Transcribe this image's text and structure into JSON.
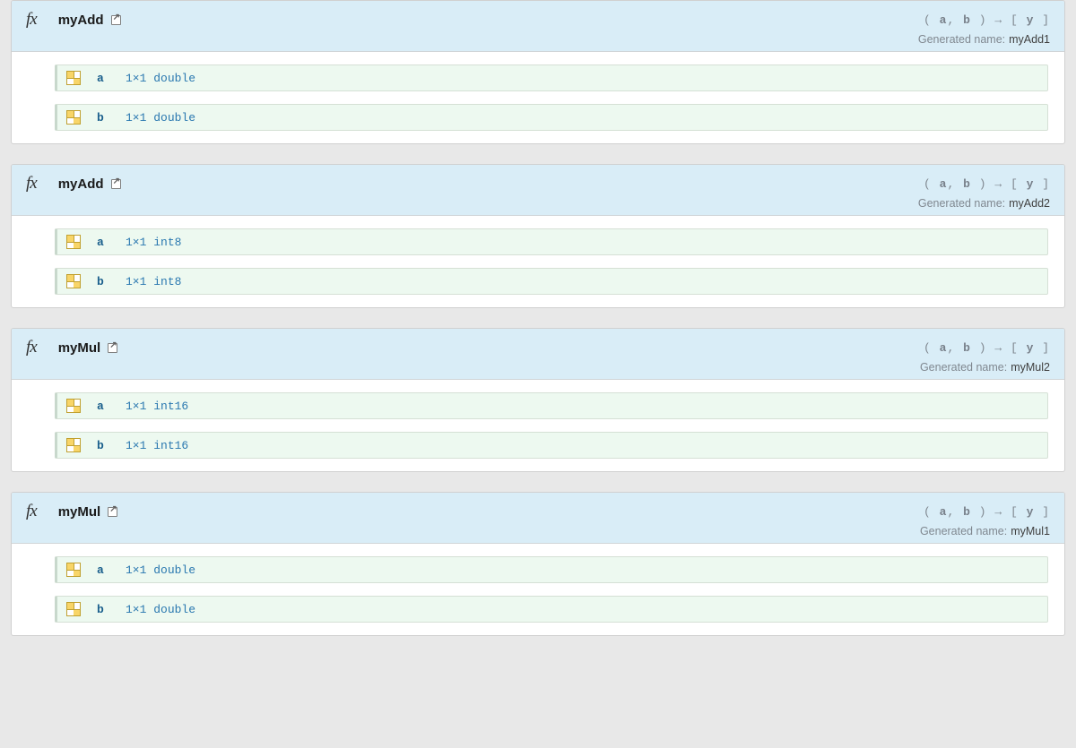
{
  "labels": {
    "generated_name": "Generated name:"
  },
  "signature": {
    "open_paren": "(",
    "comma": ",",
    "close_paren": ")",
    "arrow": "→",
    "open_bracket": "[",
    "close_bracket": "]"
  },
  "functions": [
    {
      "name": "myAdd",
      "inputs": [
        "a",
        "b"
      ],
      "outputs": [
        "y"
      ],
      "generated_name": "myAdd1",
      "params": [
        {
          "name": "a",
          "dims": "1×1",
          "type": "double"
        },
        {
          "name": "b",
          "dims": "1×1",
          "type": "double"
        }
      ]
    },
    {
      "name": "myAdd",
      "inputs": [
        "a",
        "b"
      ],
      "outputs": [
        "y"
      ],
      "generated_name": "myAdd2",
      "params": [
        {
          "name": "a",
          "dims": "1×1",
          "type": "int8"
        },
        {
          "name": "b",
          "dims": "1×1",
          "type": "int8"
        }
      ]
    },
    {
      "name": "myMul",
      "inputs": [
        "a",
        "b"
      ],
      "outputs": [
        "y"
      ],
      "generated_name": "myMul2",
      "params": [
        {
          "name": "a",
          "dims": "1×1",
          "type": "int16"
        },
        {
          "name": "b",
          "dims": "1×1",
          "type": "int16"
        }
      ]
    },
    {
      "name": "myMul",
      "inputs": [
        "a",
        "b"
      ],
      "outputs": [
        "y"
      ],
      "generated_name": "myMul1",
      "params": [
        {
          "name": "a",
          "dims": "1×1",
          "type": "double"
        },
        {
          "name": "b",
          "dims": "1×1",
          "type": "double"
        }
      ]
    }
  ]
}
